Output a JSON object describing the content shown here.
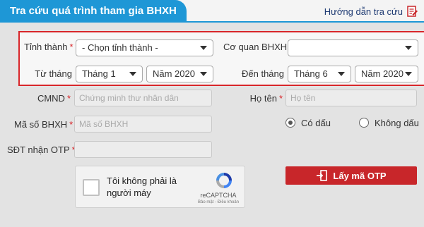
{
  "header": {
    "title": "Tra cứu quá trình tham gia BHXH",
    "guide_label": "Hướng dẫn tra cứu"
  },
  "criteria": {
    "province_label": "Tỉnh thành",
    "province_value": "- Chọn tỉnh thành -",
    "agency_label": "Cơ quan BHXH",
    "agency_value": "",
    "from_label": "Từ tháng",
    "from_month": "Tháng 1",
    "from_year": "Năm 2020",
    "to_label": "Đến tháng",
    "to_month": "Tháng 6",
    "to_year": "Năm 2020",
    "required_mark": "*"
  },
  "form": {
    "cmnd_label": "CMND",
    "cmnd_placeholder": "Chứng minh thư nhân dân",
    "name_label": "Họ tên",
    "name_placeholder": "Họ tên",
    "bhxh_label": "Mã số BHXH",
    "bhxh_placeholder": "Mã số BHXH",
    "accent_yes": "Có dấu",
    "accent_no": "Không dấu",
    "phone_label": "SĐT nhận OTP",
    "phone_placeholder": ""
  },
  "captcha": {
    "text": "Tôi không phải là người máy",
    "brand": "reCAPTCHA",
    "links": "Bảo mật - Điều khoản"
  },
  "otp_button": "Lấy mã OTP",
  "colors": {
    "brand_blue": "#1e97d6",
    "accent_red": "#c8262a"
  }
}
